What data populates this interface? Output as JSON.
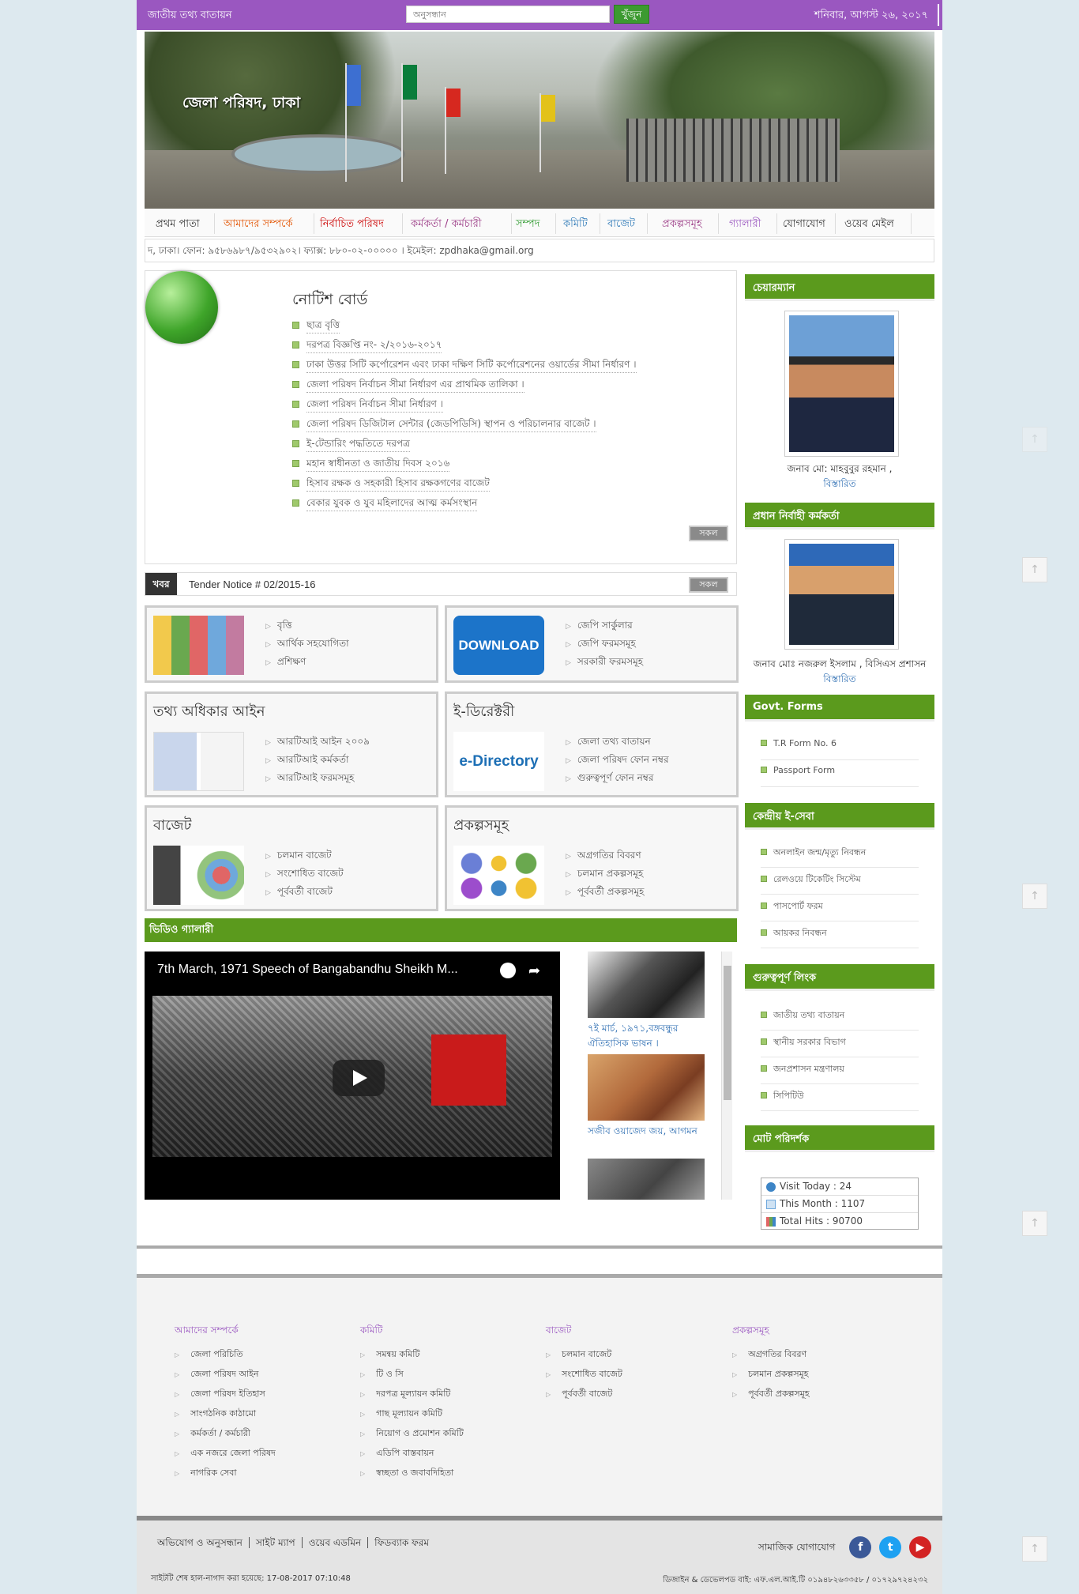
{
  "topbar": {
    "portal": "জাতীয় তথ্য বাতায়ন",
    "search_placeholder": "অনুসন্ধান",
    "search_button": "খুঁজুন",
    "date": "শনিবার, আগস্ট ২৬, ২০১৭"
  },
  "banner": {
    "title": "জেলা পরিষদ, ঢাকা"
  },
  "nav": [
    {
      "label": "প্রথম পাতা",
      "color": "#333333"
    },
    {
      "label": "আমাদের সম্পর্কে",
      "color": "#e35300"
    },
    {
      "label": "নির্বাচিত পরিষদ",
      "color": "#cc0000"
    },
    {
      "label": "কর্মকর্তা / কর্মচারী",
      "color": "#9b3b86"
    },
    {
      "label": "সম্পদ",
      "color": "#2f9a2f"
    },
    {
      "label": "কমিটি",
      "color": "#2f7ab8"
    },
    {
      "label": "বাজেট",
      "color": "#2f7ab8"
    },
    {
      "label": "প্রকল্পসমূহ",
      "color": "#9b3b86"
    },
    {
      "label": "গ্যালারী",
      "color": "#9a57c0"
    },
    {
      "label": "যোগাযোগ",
      "color": "#333333"
    },
    {
      "label": "ওয়েব মেইল",
      "color": "#333333"
    }
  ],
  "contact": "দ, ঢাকা। ফোন: ৯৫৮৬৯৮৭/৯৫৩২৯০২। ফ্যাক্স: ৮৮০-০২-০০০০০ । ইমেইল: zpdhaka@gmail.org",
  "notice": {
    "title": "নোটিশ বোর্ড",
    "items": [
      "ছাত্র বৃত্তি",
      "দরপত্র বিজ্ঞপ্তি নং- ২/২০১৬-২০১৭",
      "ঢাকা উত্তর সিটি কর্পোরেশন এবং ঢাকা দক্ষিণ সিটি কর্পোরেশনের ওয়ার্ডের সীমা নির্ধারণ ।",
      "জেলা পরিষদ নির্বাচন সীমা নির্ধারণ এর প্রাথমিক তালিকা ।",
      "জেলা পরিষদ নির্বাচন সীমা নির্ধারণ ।",
      "জেলা পরিষদ ডিজিটাল সেন্টার (জেডপিডিসি) স্থাপন ও পরিচালনার বাজেট ।",
      "ই-টেন্ডারিং পদ্ধতিতে দরপত্র",
      "মহান স্বাধীনতা ও জাতীয় দিবস ২০১৬",
      "হিসাব রক্ষক ও সহকারী হিসাব রক্ষকগণের বাজেট",
      "বেকার যুবক ও যুব মহিলাদের আত্ম কর্মসংস্থান"
    ],
    "all": "সকল"
  },
  "news": {
    "tag": "খবর",
    "text": "Tender Notice # 02/2015-16",
    "all": "সকল"
  },
  "boxes": {
    "b1": {
      "title": "",
      "items": [
        "বৃত্তি",
        "আর্থিক সহযোগিতা",
        "প্রশিক্ষণ"
      ]
    },
    "b2": {
      "title": "",
      "download": "DOWNLOAD",
      "items": [
        "জেপি সার্কুলার",
        "জেপি ফরমসমূহ",
        "সরকারী ফরমসমূহ"
      ]
    },
    "b3": {
      "title": "তথ্য অধিকার আইন",
      "items": [
        "আরটিআই আইন ২০০৯",
        "আরটিআই কর্মকর্তা",
        "আরটিআই ফরমসমূহ"
      ]
    },
    "b4": {
      "title": "ই-ডিরেক্টরী",
      "logo": "e-Directory",
      "items": [
        "জেলা তথ্য বাতায়ন",
        "জেলা পরিষদ ফোন নম্বর",
        "গুরুত্বপূর্ণ ফোন নম্বর"
      ]
    },
    "b5": {
      "title": "বাজেট",
      "items": [
        "চলমান বাজেট",
        "সংশোধিত বাজেট",
        "পূর্ববর্তী বাজেট"
      ]
    },
    "b6": {
      "title": "প্রকল্পসমূহ",
      "items": [
        "অগ্রগতির বিবরণ",
        "চলমান প্রকল্পসমূহ",
        "পূর্ববর্তী প্রকল্পসমূহ"
      ]
    }
  },
  "video": {
    "heading": "ভিডিও গ্যালারী",
    "title": "7th March, 1971 Speech of Bangabandhu Sheikh M...",
    "list": [
      "৭ই মার্চ, ১৯৭১,বঙ্গবন্ধুর ঐতিহাসিক ভাষন ।",
      "সজীব ওয়াজেদ জয়, আগমন"
    ]
  },
  "sidebar": {
    "chairman": {
      "heading": "চেয়ারম্যান",
      "name": "জনাব মো: মাহবুবুর রহমান ,",
      "link": "বিস্তারিত"
    },
    "ceo": {
      "heading": "প্রধান নির্বাহী কর্মকর্তা",
      "name": "জনাব মোঃ নজরুল ইসলাম , বিসিএস প্রশাসন",
      "link": "বিস্তারিত"
    },
    "forms": {
      "heading": "Govt. Forms",
      "items": [
        "T.R Form No. 6",
        "Passport Form"
      ]
    },
    "eservice": {
      "heading": "কেন্দ্রীয় ই-সেবা",
      "items": [
        "অনলাইন জন্ম/মৃত্যু নিবন্ধন",
        "রেলওয়ে টিকেটিং সিস্টেম",
        "পাসপোর্ট ফরম",
        "আয়কর নিবন্ধন"
      ]
    },
    "links": {
      "heading": "গুরুত্বপূর্ণ লিংক",
      "items": [
        "জাতীয় তথ্য বাতায়ন",
        "স্থানীয় সরকার বিভাগ",
        "জনপ্রশাসন মন্ত্রণালয়",
        "সিপিটিউ"
      ]
    },
    "visitors": {
      "heading": "মোট পরিদর্শক",
      "today": "Visit Today : 24",
      "month": "This Month : 1107",
      "total": "Total Hits : 90700"
    }
  },
  "footer": {
    "cols": [
      {
        "heading": "আমাদের সম্পর্কে",
        "items": [
          "জেলা পরিচিতি",
          "জেলা পরিষদ আইন",
          "জেলা পরিষদ ইতিহাস",
          "সাংগঠনিক কাঠামো",
          "কর্মকর্তা / কর্মচারী",
          "এক নজরে জেলা পরিষদ",
          "নাগরিক সেবা"
        ]
      },
      {
        "heading": "কমিটি",
        "items": [
          "সমন্বয় কমিটি",
          "টি ও সি",
          "দরপত্র মূল্যায়ন কমিটি",
          "গাছ মূল্যায়ন কমিটি",
          "নিয়োগ ও প্রমোশন কমিটি",
          "এডিপি বাস্তবায়ন",
          "স্বচ্ছতা ও জবাবদিহিতা"
        ]
      },
      {
        "heading": "বাজেট",
        "items": [
          "চলমান বাজেট",
          "সংশোধিত বাজেট",
          "পূর্ববর্তী বাজেট"
        ]
      },
      {
        "heading": "প্রকল্পসমূহ",
        "items": [
          "অগ্রগতির বিবরণ",
          "চলমান প্রকল্পসমূহ",
          "পূর্ববর্তী প্রকল্পসমূহ"
        ]
      }
    ],
    "links": [
      "অভিযোগ ও অনুসন্ধান",
      "সাইট ম্যাপ",
      "ওয়েব এডমিন",
      "ফিডব্যাক ফরম"
    ],
    "social_label": "সামাজিক যোগাযোগ",
    "updated": "সাইটটি শেষ হাল-নাগাদ করা হয়েছে:     17-08-2017 07:10:48",
    "developer": "ডিজাইন & ডেভেলপড বাই: এফ.এল.আই.টি ০১৯৪৮২৬৩৩৫৮ / ০১৭২৯৭২৪২৩২"
  },
  "colors": {
    "brand": "#9a57c0",
    "green": "#5b9a1d"
  }
}
